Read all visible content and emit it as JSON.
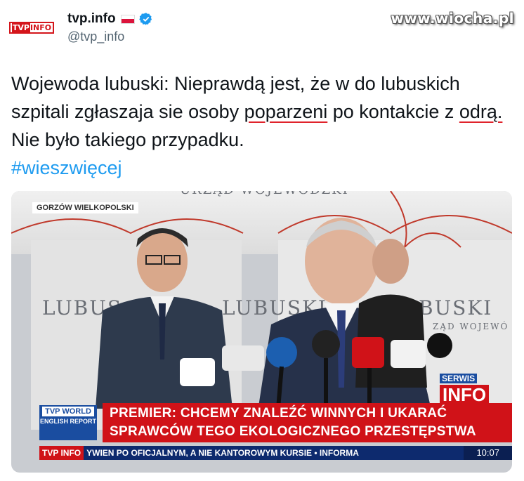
{
  "watermark": "www.wiocha.pl",
  "tweet": {
    "avatar_logo": "TVP INFO",
    "display_name": "tvp.info",
    "handle": "@tvp_info",
    "text_part1": "Wojewoda lubuski: Nieprawdą jest, że w do lubuskich szpitali zgłaszaja sie osoby ",
    "text_underlined1": "poparzeni",
    "text_part2": " po kontakcie z ",
    "text_underlined2": "odrą.",
    "text_part3": " Nie było takiego przypadku.",
    "hashtag": "#wieszwięcej"
  },
  "media": {
    "location": "GORZÓW WIELKOPOLSKI",
    "banner_top": "URZĄD WOJEWÓDZKI",
    "banner_left": "LUBUS",
    "banner_mid": "LUBUSKI",
    "banner_right": "BUSKI",
    "banner_right_sub": "ZĄD WOJEWÓ",
    "world_logo_top": "TVP WORLD",
    "world_logo_sub": "ENGLISH REPORT",
    "headline": "PREMIER: CHCEMY ZNALEŹĆ WINNYCH I UKARAĆ SPRAWCÓW TEGO EKOLOGICZNEGO PRZESTĘPSTWA",
    "channel_logo": "TVP INFO",
    "crawl": "YWIEN PO OFICJALNYM, A NIE KANTOROWYM KURSIE • INFORMA",
    "clock": "10:07",
    "serwis_top": "SERWIS",
    "serwis_bottom": "INFO"
  },
  "colors": {
    "tvp_red": "#d01218",
    "link_blue": "#1d9bf0",
    "verified_blue": "#1d9bf0"
  }
}
